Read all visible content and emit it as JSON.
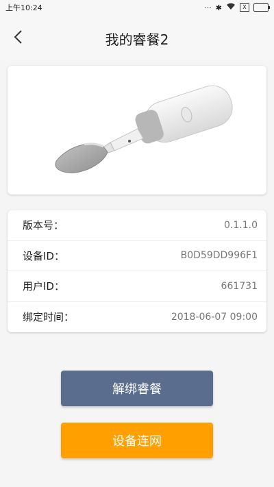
{
  "status_bar": {
    "time": "上午10:24",
    "sim_label": "X"
  },
  "header": {
    "title": "我的睿餐2"
  },
  "device_info": {
    "rows": [
      {
        "label": "版本号：",
        "value": "0.1.1.0"
      },
      {
        "label": "设备ID：",
        "value": "B0D59DD996F1"
      },
      {
        "label": "用户ID：",
        "value": "661731"
      },
      {
        "label": "绑定时间：",
        "value": "2018-06-07 09:00"
      }
    ]
  },
  "actions": {
    "unbind_label": "解绑睿餐",
    "network_label": "设备连网"
  },
  "colors": {
    "unbind_button": "#5b6d8e",
    "network_button": "#ff9f00"
  }
}
